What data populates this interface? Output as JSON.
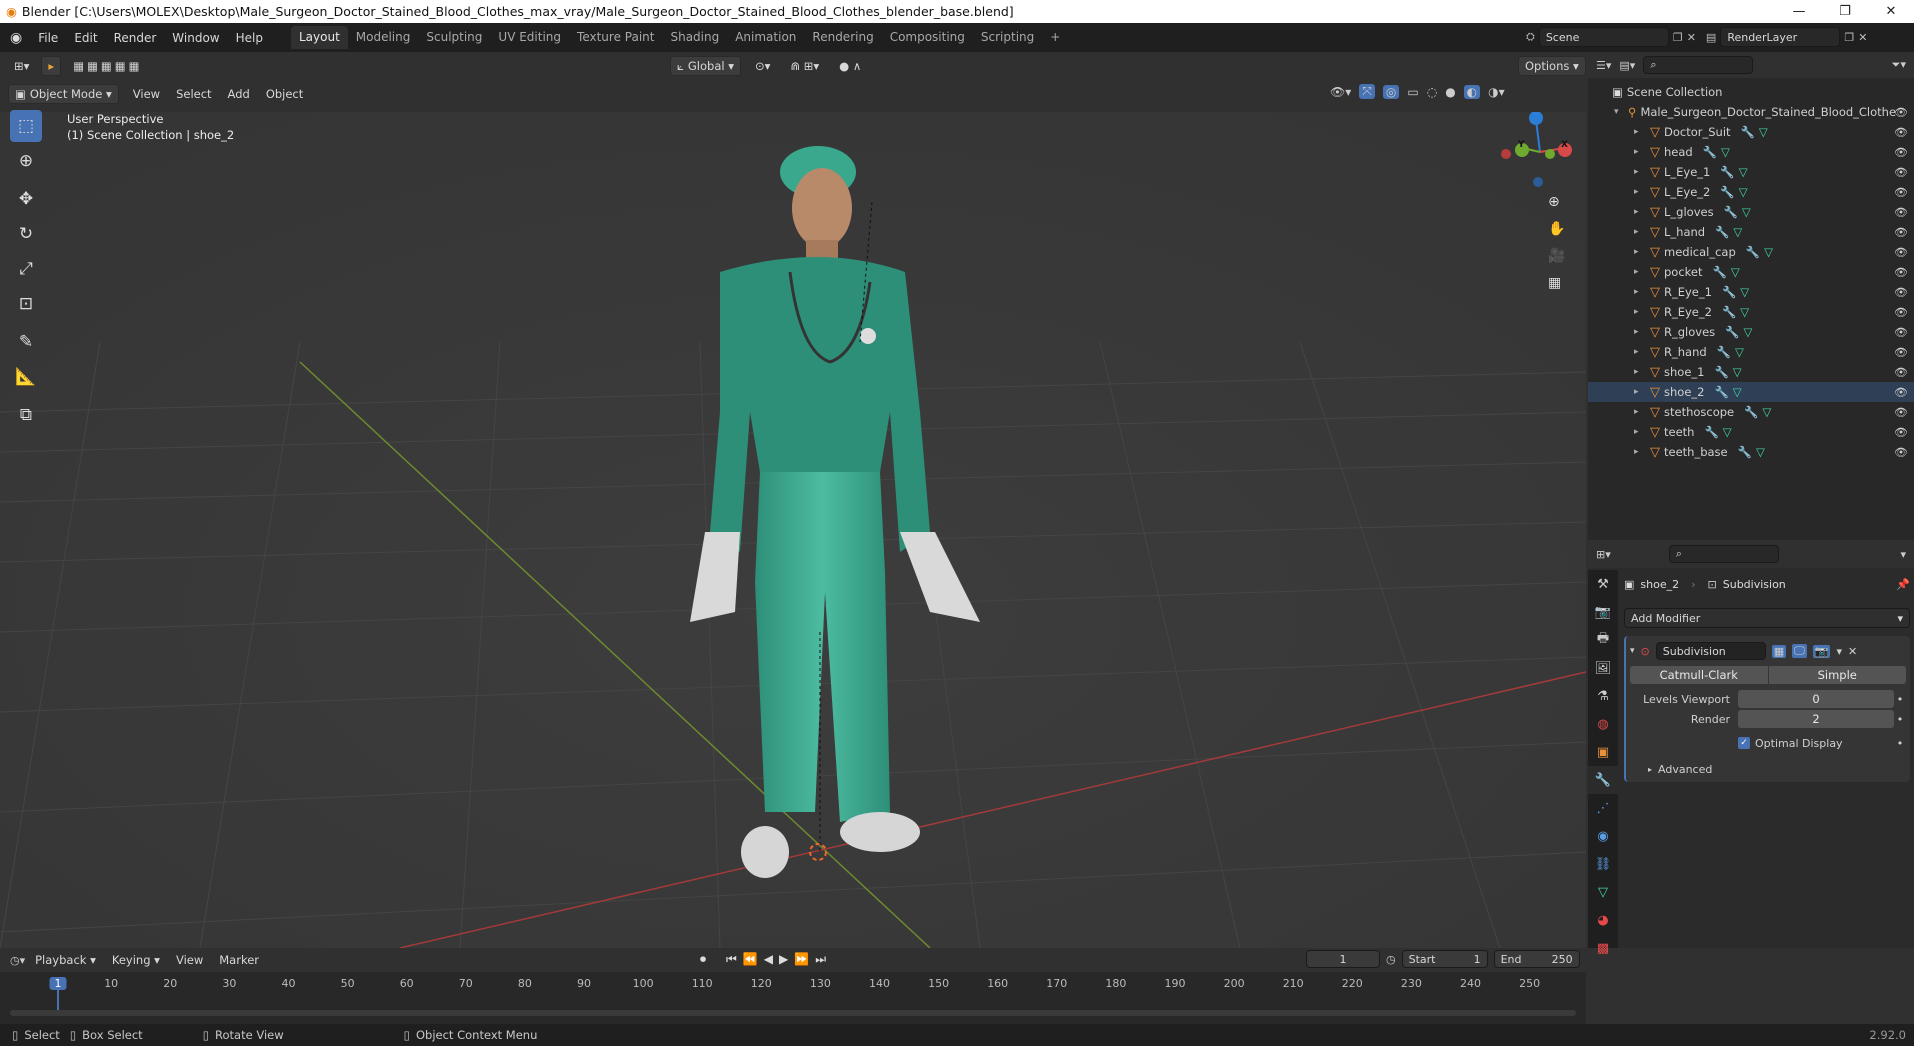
{
  "titlebar": {
    "title": "Blender [C:\\Users\\MOLEX\\Desktop\\Male_Surgeon_Doctor_Stained_Blood_Clothes_max_vray/Male_Surgeon_Doctor_Stained_Blood_Clothes_blender_base.blend]"
  },
  "menu": [
    "File",
    "Edit",
    "Render",
    "Window",
    "Help"
  ],
  "workspaces": [
    "Layout",
    "Modeling",
    "Sculpting",
    "UV Editing",
    "Texture Paint",
    "Shading",
    "Animation",
    "Rendering",
    "Compositing",
    "Scripting"
  ],
  "scene": {
    "name": "Scene",
    "render_layer": "RenderLayer"
  },
  "viewport_header": {
    "orientation": "Global",
    "options": "Options",
    "mode": "Object Mode",
    "menus": [
      "View",
      "Select",
      "Add",
      "Object"
    ]
  },
  "viewport": {
    "perspective": "User Perspective",
    "collection_info": "(1) Scene Collection | shoe_2"
  },
  "gizmo": {
    "z": "Z",
    "y": "Y",
    "x": "X"
  },
  "outliner": {
    "root": "Scene Collection",
    "collection": "Male_Surgeon_Doctor_Stained_Blood_Clothe",
    "objects": [
      "Doctor_Suit",
      "head",
      "L_Eye_1",
      "L_Eye_2",
      "L_gloves",
      "L_hand",
      "medical_cap",
      "pocket",
      "R_Eye_1",
      "R_Eye_2",
      "R_gloves",
      "R_hand",
      "shoe_1",
      "shoe_2",
      "stethoscope",
      "teeth",
      "teeth_base"
    ]
  },
  "properties": {
    "object": "shoe_2",
    "modifier_type": "Subdivision",
    "add_modifier": "Add Modifier",
    "modifier_name": "Subdivision",
    "algo_active": "Catmull-Clark",
    "algo_other": "Simple",
    "levels_viewport_label": "Levels Viewport",
    "levels_viewport": "0",
    "render_label": "Render",
    "render": "2",
    "optimal_display": "Optimal Display",
    "advanced": "Advanced"
  },
  "timeline": {
    "menus": [
      "Playback",
      "Keying",
      "View",
      "Marker"
    ],
    "current_frame": "1",
    "start_label": "Start",
    "start": "1",
    "end_label": "End",
    "end": "250",
    "ticks": [
      "1",
      "10",
      "20",
      "30",
      "40",
      "50",
      "60",
      "70",
      "80",
      "90",
      "100",
      "110",
      "120",
      "130",
      "140",
      "150",
      "160",
      "170",
      "180",
      "190",
      "200",
      "210",
      "220",
      "230",
      "240",
      "250"
    ]
  },
  "statusbar": {
    "select": "Select",
    "box_select": "Box Select",
    "rotate": "Rotate View",
    "context": "Object Context Menu",
    "version": "2.92.0"
  }
}
